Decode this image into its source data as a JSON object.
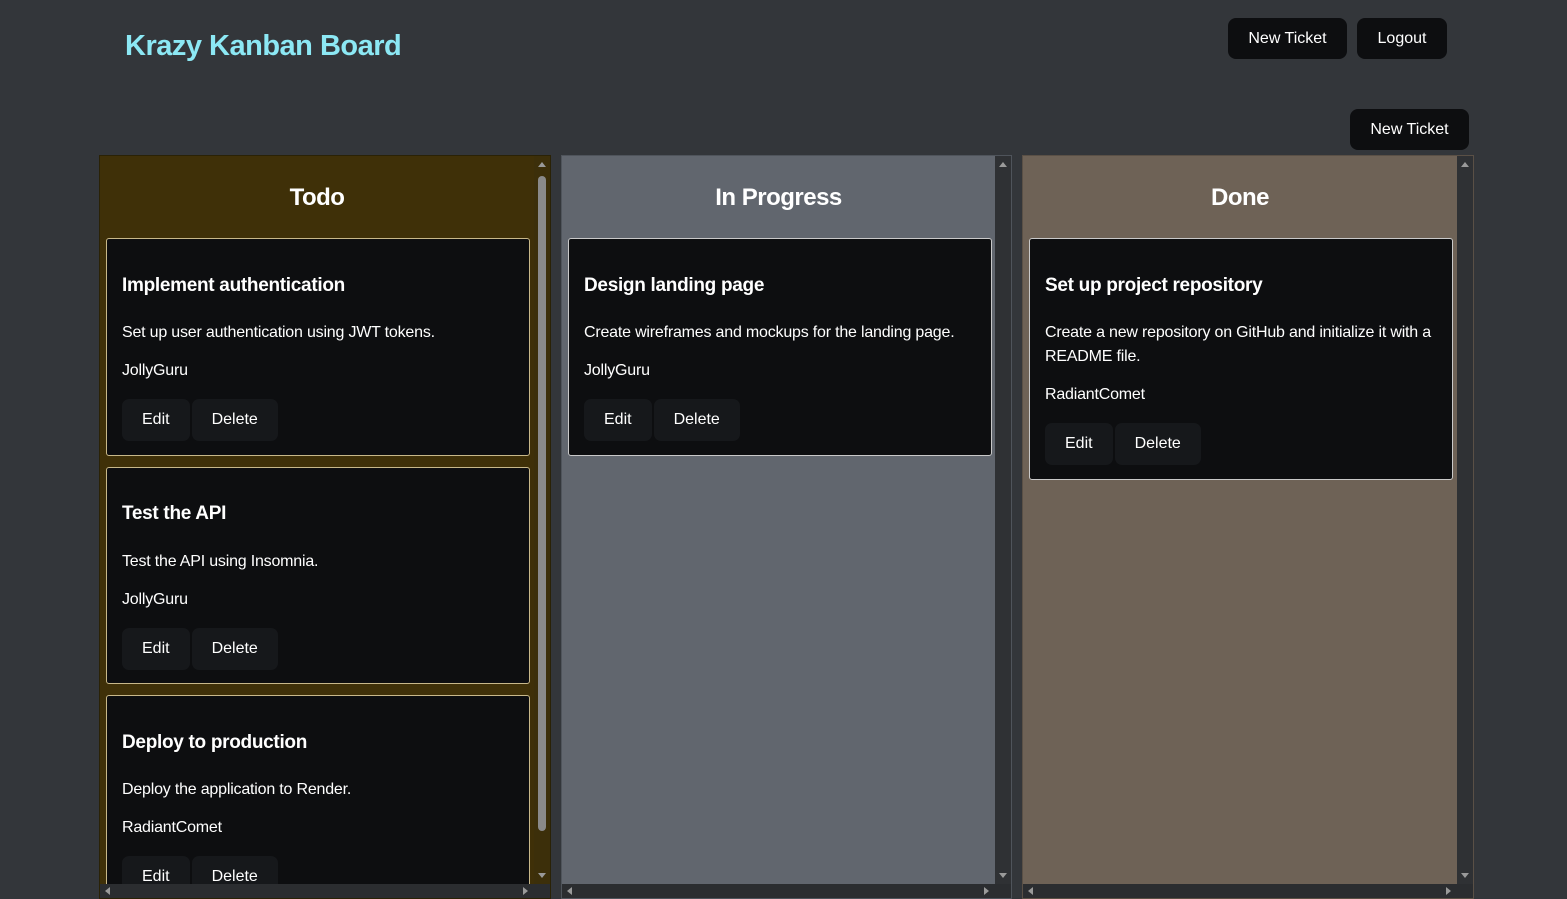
{
  "app": {
    "title": "Krazy Kanban Board"
  },
  "nav": {
    "new_ticket_label": "New Ticket",
    "logout_label": "Logout"
  },
  "board": {
    "new_ticket_label": "New Ticket"
  },
  "columns": [
    {
      "title": "Todo",
      "cards": [
        {
          "title": "Implement authentication",
          "description": "Set up user authentication using JWT tokens.",
          "assignee": "JollyGuru",
          "edit_label": "Edit",
          "delete_label": "Delete"
        },
        {
          "title": "Test the API",
          "description": "Test the API using Insomnia.",
          "assignee": "JollyGuru",
          "edit_label": "Edit",
          "delete_label": "Delete"
        },
        {
          "title": "Deploy to production",
          "description": "Deploy the application to Render.",
          "assignee": "RadiantComet",
          "edit_label": "Edit",
          "delete_label": "Delete"
        }
      ]
    },
    {
      "title": "In Progress",
      "cards": [
        {
          "title": "Design landing page",
          "description": "Create wireframes and mockups for the landing page.",
          "assignee": "JollyGuru",
          "edit_label": "Edit",
          "delete_label": "Delete"
        }
      ]
    },
    {
      "title": "Done",
      "cards": [
        {
          "title": "Set up project repository",
          "description": "Create a new repository on GitHub and initialize it with a README file.",
          "assignee": "RadiantComet",
          "edit_label": "Edit",
          "delete_label": "Delete"
        }
      ]
    }
  ],
  "colors": {
    "brand": "#8ce8f4",
    "background": "#33363a",
    "todo_column": "#3f3008",
    "in_progress_column": "#61666e",
    "done_column": "#6e6256",
    "card": "#0d0e10"
  }
}
